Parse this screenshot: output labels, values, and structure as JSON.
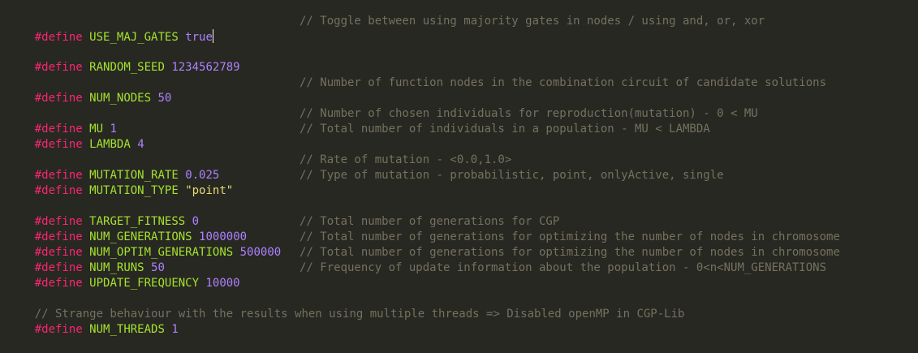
{
  "colors": {
    "background": "#272822",
    "keyword": "#F92672",
    "identifier": "#A6E22E",
    "number": "#AE81FF",
    "string": "#E6DB74",
    "comment": "#75715E"
  },
  "lines": [
    {
      "keyword": "#define",
      "name": "USE_MAJ_GATES",
      "value": "true",
      "comment": "// Toggle between using majority gates in nodes / using and, or, xor"
    },
    {
      "keyword": "#define",
      "name": "RANDOM_SEED",
      "value": "1234562789"
    },
    {
      "keyword": "#define",
      "name": "NUM_NODES",
      "value": "50",
      "comment": "// Number of function nodes in the combination circuit of candidate solutions"
    },
    {
      "keyword": "#define",
      "name": "MU",
      "value": "1",
      "comment": "// Number of chosen individuals for reproduction(mutation) - 0 < MU"
    },
    {
      "keyword": "#define",
      "name": "LAMBDA",
      "value": "4",
      "comment": "// Total number of individuals in a population - MU < LAMBDA"
    },
    {
      "keyword": "#define",
      "name": "MUTATION_RATE",
      "value": "0.025",
      "comment": "// Rate of mutation - <0.0,1.0>"
    },
    {
      "keyword": "#define",
      "name": "MUTATION_TYPE",
      "value": "\"point\"",
      "comment": "// Type of mutation - probabilistic, point, onlyActive, single"
    },
    {
      "keyword": "#define",
      "name": "TARGET_FITNESS",
      "value": "0"
    },
    {
      "keyword": "#define",
      "name": "NUM_GENERATIONS",
      "value": "1000000",
      "comment": "// Total number of generations for CGP"
    },
    {
      "keyword": "#define",
      "name": "NUM_OPTIM_GENERATIONS",
      "value": "500000",
      "comment": "// Total number of generations for optimizing the number of nodes in chromosome"
    },
    {
      "keyword": "#define",
      "name": "NUM_RUNS",
      "value": "50",
      "comment": "// Total number of generations for optimizing the number of nodes in chromosome"
    },
    {
      "keyword": "#define",
      "name": "UPDATE_FREQUENCY",
      "value": "10000",
      "comment": "// Frequency of update information about the population - 0<n<NUM_GENERATIONS"
    },
    {
      "full_comment": "// Strange behaviour with the results when using multiple threads => Disabled openMP in CGP-Lib"
    },
    {
      "keyword": "#define",
      "name": "NUM_THREADS",
      "value": "1"
    }
  ]
}
